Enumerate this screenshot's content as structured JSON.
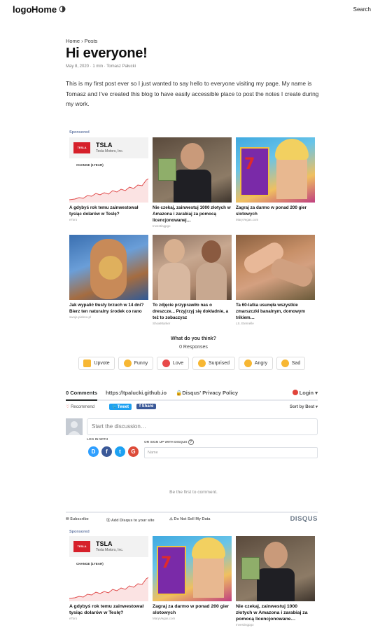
{
  "header": {
    "logo": "logo",
    "home": "Home",
    "theme_icon": "half-moon-icon",
    "search": "Search"
  },
  "post": {
    "breadcrumb": "Home › Posts",
    "title": "Hi everyone!",
    "meta": "May 8, 2020 · 1 min · Tomasz Pałucki",
    "body": "This is my first post ever so I just wanted to say hello to everyone visiting my page. My name is Tomasz and I've created this blog to have easily accessible place to post the notes I create during my work."
  },
  "ads_top": {
    "label": "Sponsored",
    "items": [
      {
        "title": "A gdybyś rok temu zainwestował tysiąc dolarów w Teslę?",
        "source": "eToro",
        "ticker": "TSLA",
        "company": "Tesla Motors, Inc.",
        "logo_text": "TESLA",
        "change_label": "CHANGE (1YEAR)"
      },
      {
        "title": "Nie czekaj, zainwestuj 1000 złotych w Amazona i zarabiaj za pomocą licencjonowanej…",
        "source": "Investingpgo"
      },
      {
        "title": "Zagraj za darmo w ponad 200 gier slotowych",
        "source": "MaryVegas.com"
      },
      {
        "title": "Jak wypalić tłusty brzuch w 14 dni? Bierz ten naturalny środek co rano",
        "source": "swoje-piekno.pl"
      },
      {
        "title": "To zdjęcie przyprawiło nas o dreszcze... Przyjrzyj się dokładnie, a też to zobaczysz",
        "source": "ShowMarker"
      },
      {
        "title": "Ta 60-latka usunęła wszystkie zmarszczki banalnym, domowym trikiem…",
        "source": "LS. Eternelle"
      }
    ]
  },
  "reactions": {
    "question": "What do you think?",
    "responses": "0 Responses",
    "items": [
      {
        "label": "Upvote",
        "icon": "thumbs-up-icon",
        "color": "#f7b733"
      },
      {
        "label": "Funny",
        "icon": "laughing-face-icon",
        "color": "#f7b733"
      },
      {
        "label": "Love",
        "icon": "heart-eyes-icon",
        "color": "#f7b733"
      },
      {
        "label": "Surprised",
        "icon": "surprised-face-icon",
        "color": "#f7b733"
      },
      {
        "label": "Angry",
        "icon": "angry-face-icon",
        "color": "#f7b733"
      },
      {
        "label": "Sad",
        "icon": "sad-face-icon",
        "color": "#f7b733"
      }
    ]
  },
  "disqus": {
    "comments_tab": "0 Comments",
    "site": "https://tpalucki.github.io",
    "privacy": "Disqus' Privacy Policy",
    "login": "Login",
    "recommend": "Recommend",
    "tweet": "Tweet",
    "share": "Share",
    "sort": "Sort by Best",
    "placeholder": "Start the discussion…",
    "login_with": "LOG IN WITH",
    "signup_with": "OR SIGN UP WITH DISQUS",
    "name_placeholder": "Name",
    "first_comment": "Be the first to comment.",
    "subscribe": "Subscribe",
    "add_disqus": "Add Disqus to your site",
    "do_not_sell": "Do Not Sell My Data",
    "brand": "DISQUS",
    "social": [
      {
        "letter": "D",
        "color": "#2e9fff"
      },
      {
        "letter": "f",
        "color": "#3b5998"
      },
      {
        "letter": "t",
        "color": "#1da1f2"
      },
      {
        "letter": "G",
        "color": "#dd4b39"
      }
    ]
  },
  "ads_bottom": {
    "label": "Sponsored",
    "items": [
      {
        "title": "A gdybyś rok temu zainwestował tysiąc dolarów w Teslę?",
        "source": "eToro",
        "ticker": "TSLA",
        "company": "Tesla Motors, Inc.",
        "logo_text": "TESLA",
        "change_label": "CHANGE (1YEAR)"
      },
      {
        "title": "Zagraj za darmo w ponad 200 gier slotowych",
        "source": "MaryVegas.com"
      },
      {
        "title": "Nie czekaj, zainwestuj 1000 złotych w Amazona i zarabiaj za pomocą licencjonowane…",
        "source": "Investingpgo"
      }
    ]
  }
}
